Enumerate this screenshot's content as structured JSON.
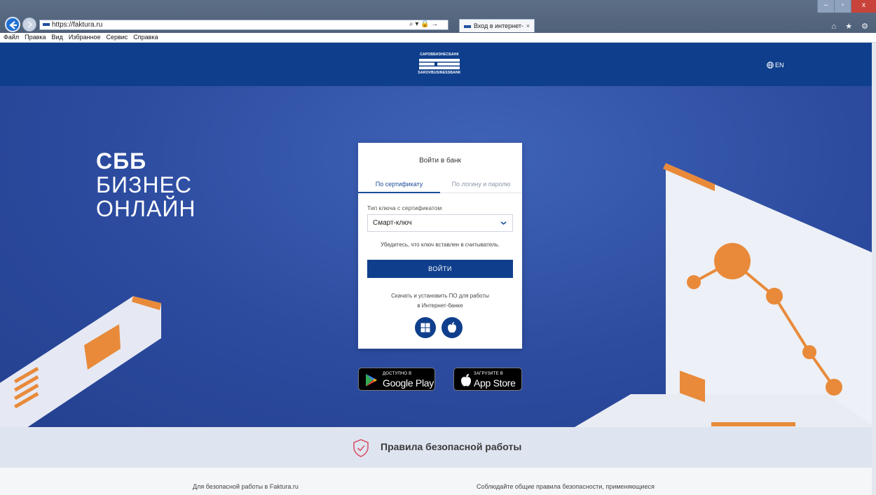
{
  "browser": {
    "url": "https://faktura.ru",
    "tab_title": "Вход в интернет-банк",
    "tab_close": "×",
    "addr_tools": "⌕ ▾ 🔒 →",
    "window_controls": {
      "minimize": "–",
      "maximize": "▫",
      "close": "x"
    },
    "ie_icons": "⌂ ★ ⚙",
    "menu": [
      "Файл",
      "Правка",
      "Вид",
      "Избранное",
      "Сервис",
      "Справка"
    ]
  },
  "header": {
    "logo_top": "САРОВБИЗНЕСБАНК",
    "logo_bottom": "SAROVBUSINESSBANK",
    "lang": "EN"
  },
  "hero": {
    "line1": "СББ",
    "line2": "БИЗНЕС",
    "line3": "ОНЛАЙН"
  },
  "login": {
    "title": "Войти в банк",
    "tab_cert": "По сертификату",
    "tab_login": "По логину и паролю",
    "field_label": "Тип ключа с сертификатом",
    "select_value": "Смарт-ключ",
    "hint": "Убедитесь, что ключ вставлен в считыватель.",
    "button": "ВОЙТИ",
    "download_line1": "Скачать и установить ПО для работы",
    "download_line2": "в Интернет-банке"
  },
  "stores": {
    "gp_small": "ДОСТУПНО В",
    "gp_big": "Google Play",
    "as_small": "Загрузите в",
    "as_big": "App Store"
  },
  "footer": {
    "rules_title": "Правила безопасной работы",
    "col1": "Для безопасной работы в Faktura.ru",
    "col2": "Соблюдайте общие правила безопасности, применяющиеся"
  },
  "colors": {
    "brand_blue": "#0f3f8c",
    "hero_blue": "#2c4b9f",
    "accent_orange": "#e88a3a"
  }
}
